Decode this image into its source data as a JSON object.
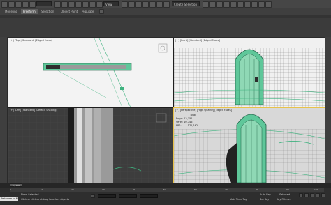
{
  "tabs": [
    {
      "label": "Modeling"
    },
    {
      "label": "Freeform"
    },
    {
      "label": "Selection"
    },
    {
      "label": "Object Paint"
    },
    {
      "label": "Populate"
    }
  ],
  "toolbar": {
    "view_combo": "View",
    "selection_set": "Create Selection Se"
  },
  "viewports": {
    "top": {
      "label": "[+] [Top] [Standard] [Edged Faces]"
    },
    "front": {
      "label": "[+] [Front] [Standard] [Edged Faces]"
    },
    "left": {
      "label": "[+] [Left] [Standard] [Default Shading]"
    },
    "perspective": {
      "label": "[+] [Perspective] [High Quality] [Edged Faces]",
      "stats_title": "Total",
      "polys": "Polys:  12,151",
      "verts": "Verts:  10,746",
      "fps_label": "FPS:",
      "fps_value": "172,162"
    }
  },
  "status": {
    "listener": "Welcome to M",
    "none_selected": "None Selected",
    "hint": "Click or click-and-drag to select objects",
    "auto_key": "Auto Key",
    "set_key": "Set Key",
    "selected": "Selected",
    "key_filters": "Key Filters...",
    "add_time_tag": "Add Time Tag",
    "frame_counter": "0 / 100"
  },
  "timeline_ticks": [
    "0",
    "10",
    "20",
    "30",
    "40",
    "50",
    "60",
    "70",
    "80",
    "90",
    "100"
  ],
  "colors": {
    "accent": "#e8c24a",
    "door": "#5fc79a",
    "wire": "#2d2d2d"
  }
}
